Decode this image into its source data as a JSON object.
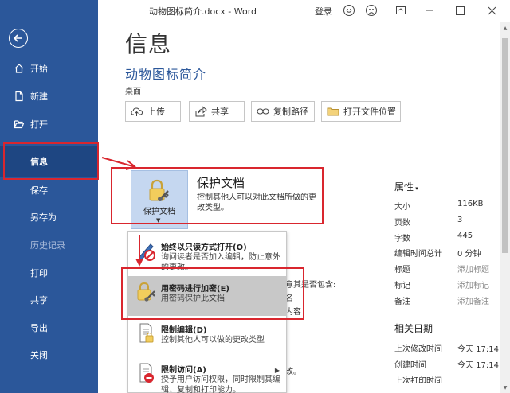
{
  "window": {
    "title": "动物图标简介.docx - Word",
    "login": "登录"
  },
  "sidebar": {
    "items": [
      {
        "label": "开始"
      },
      {
        "label": "新建"
      },
      {
        "label": "打开"
      },
      {
        "label": "信息"
      },
      {
        "label": "保存"
      },
      {
        "label": "另存为"
      },
      {
        "label": "历史记录"
      },
      {
        "label": "打印"
      },
      {
        "label": "共享"
      },
      {
        "label": "导出"
      },
      {
        "label": "关闭"
      }
    ]
  },
  "main": {
    "title": "信息",
    "doc_name": "动物图标简介",
    "doc_location": "桌面",
    "toolbar": {
      "upload": "上传",
      "share": "共享",
      "copy_path": "复制路径",
      "open_location": "打开文件位置"
    },
    "protect": {
      "tile_label": "保护文档",
      "heading": "保护文档",
      "description": "控制其他人可以对此文档所做的更改类型。"
    },
    "dropdown": [
      {
        "title": "始终以只读方式打开(O)",
        "desc": "询问读者是否加入编辑，防止意外的更改。"
      },
      {
        "title": "用密码进行加密(E)",
        "desc": "用密码保护此文档"
      },
      {
        "title": "限制编辑(D)",
        "desc": "控制其他人可以做的更改类型"
      },
      {
        "title": "限制访问(A)",
        "desc": "授予用户访问权限，同时限制其编辑、复制和打印能力。"
      }
    ],
    "background_text": {
      "line1": "意其是否包含:",
      "line2": "名",
      "line3": "内容",
      "line4": "改。"
    }
  },
  "properties": {
    "heading": "属性",
    "rows": [
      {
        "label": "大小",
        "value": "116KB"
      },
      {
        "label": "页数",
        "value": "3"
      },
      {
        "label": "字数",
        "value": "445"
      },
      {
        "label": "编辑时间总计",
        "value": "0 分钟"
      },
      {
        "label": "标题",
        "value": "添加标题"
      },
      {
        "label": "标记",
        "value": "添加标记"
      },
      {
        "label": "备注",
        "value": "添加备注"
      }
    ],
    "dates_heading": "相关日期",
    "dates": [
      {
        "label": "上次修改时间",
        "value": "今天 17:14"
      },
      {
        "label": "创建时间",
        "value": "今天 17:14"
      },
      {
        "label": "上次打印时间",
        "value": ""
      }
    ]
  },
  "colors": {
    "sidebar": "#2b579a",
    "sidebar_active": "#1e4682",
    "annotation_red": "#d9262e",
    "accent_text": "#2b579a"
  }
}
